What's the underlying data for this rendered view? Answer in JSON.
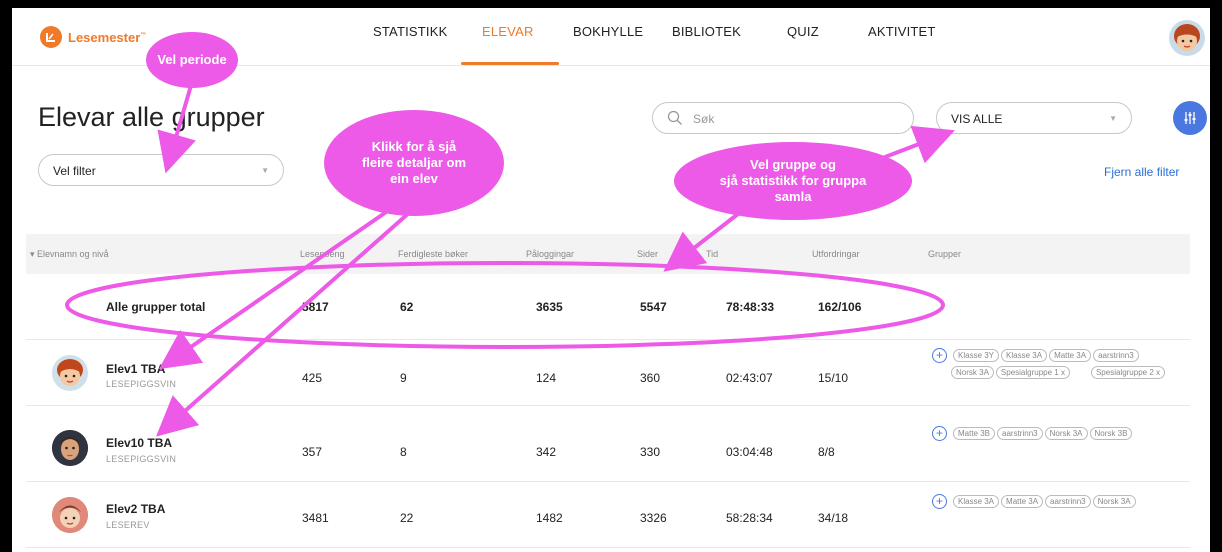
{
  "app": {
    "brand": "Lesemester",
    "brand_mark": "™"
  },
  "nav": [
    {
      "label": "STATISTIKK"
    },
    {
      "label": "ELEVAR"
    },
    {
      "label": "BOKHYLLE"
    },
    {
      "label": "BIBLIOTEK"
    },
    {
      "label": "QUIZ"
    },
    {
      "label": "AKTIVITET"
    }
  ],
  "page": {
    "title": "Elevar alle grupper",
    "filter_select": "Vel filter",
    "search_placeholder": "Søk",
    "group_select": "VIS ALLE",
    "clear_filters": "Fjern alle filter"
  },
  "table": {
    "headers": [
      "Elevnamn og nivå",
      "Lesepoeng",
      "Ferdigleste bøker",
      "Påloggingar",
      "Sider",
      "Tid",
      "Utfordringar",
      "Grupper"
    ],
    "total": {
      "label": "Alle grupper total",
      "lesepoeng": "5817",
      "boker": "62",
      "palogg": "3635",
      "sider": "5547",
      "tid": "78:48:33",
      "utfordringar": "162/106"
    },
    "rows": [
      {
        "name": "Elev1 TBA",
        "level": "LESEPIGGSVIN",
        "lesepoeng": "425",
        "boker": "9",
        "palogg": "124",
        "sider": "360",
        "tid": "02:43:07",
        "utfordringar": "15/10",
        "groups": [
          "Klasse 3Y",
          "Klasse 3A",
          "Matte 3A",
          "aarstrinn3",
          "Norsk 3A",
          "Spesialgruppe 1  x",
          "Spesialgruppe 2  x"
        ]
      },
      {
        "name": "Elev10 TBA",
        "level": "LESEPIGGSVIN",
        "lesepoeng": "357",
        "boker": "8",
        "palogg": "342",
        "sider": "330",
        "tid": "03:04:48",
        "utfordringar": "8/8",
        "groups": [
          "Matte 3B",
          "aarstrinn3",
          "Norsk 3A",
          "Norsk 3B"
        ]
      },
      {
        "name": "Elev2 TBA",
        "level": "LESEREV",
        "lesepoeng": "3481",
        "boker": "22",
        "palogg": "1482",
        "sider": "3326",
        "tid": "58:28:34",
        "utfordringar": "34/18",
        "groups": [
          "Klasse 3A",
          "Matte 3A",
          "aarstrinn3",
          "Norsk 3A"
        ]
      }
    ]
  },
  "annotations": {
    "period": "Vel periode",
    "details": [
      "Klikk for å sjå",
      "fleire detaljar om",
      "ein elev"
    ],
    "group": [
      "Vel gruppe og",
      "sjå statistikk for gruppa",
      "samla"
    ]
  },
  "colors": {
    "accent": "#f07a2a",
    "annotation": "#ec5ae7",
    "link": "#2b6fd6",
    "button": "#4a78e0"
  }
}
